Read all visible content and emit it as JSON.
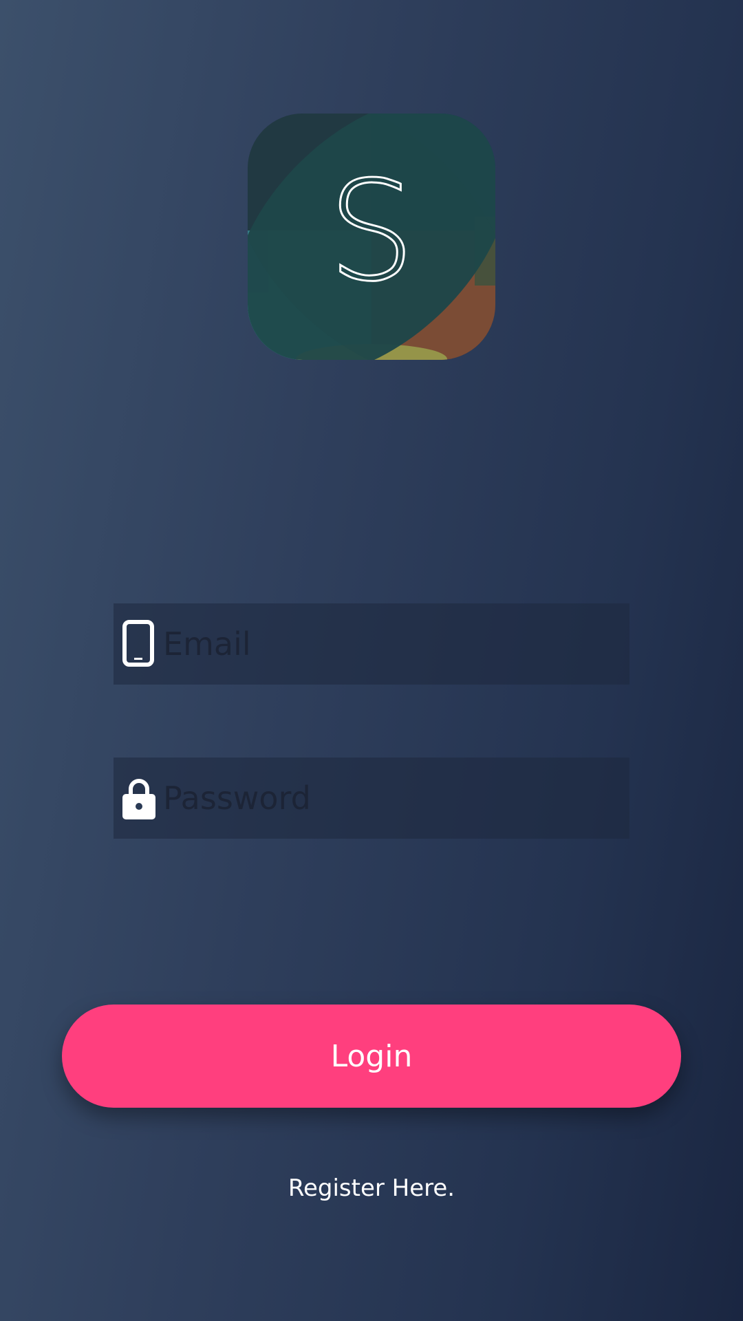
{
  "logo": {
    "letter": "S",
    "icon": "app-logo-icon"
  },
  "form": {
    "email": {
      "placeholder": "Email",
      "value": "",
      "icon": "phone-icon"
    },
    "password": {
      "placeholder": "Password",
      "value": "",
      "icon": "lock-icon"
    }
  },
  "actions": {
    "login_label": "Login",
    "register_label": "Register Here."
  },
  "colors": {
    "background_start": "#3c506b",
    "background_end": "#1a2641",
    "accent": "#ff3f7e",
    "input_text": "#1c2436"
  }
}
